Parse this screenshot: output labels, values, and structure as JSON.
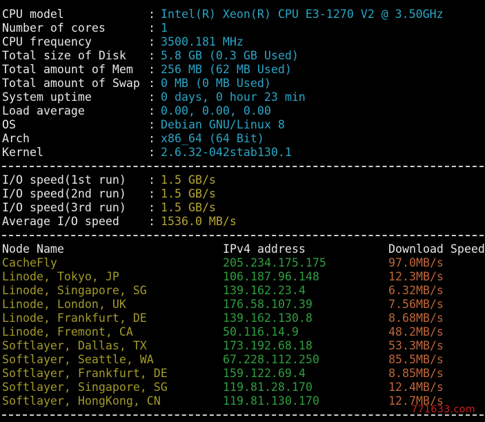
{
  "system_info": [
    {
      "label": "CPU model",
      "value": "Intel(R) Xeon(R) CPU E3-1270 V2 @ 3.50GHz"
    },
    {
      "label": "Number of cores",
      "value": "1"
    },
    {
      "label": "CPU frequency",
      "value": "3500.181 MHz"
    },
    {
      "label": "Total size of Disk",
      "value": "5.8 GB (0.3 GB Used)"
    },
    {
      "label": "Total amount of Mem",
      "value": "256 MB (62 MB Used)"
    },
    {
      "label": "Total amount of Swap",
      "value": "0 MB (0 MB Used)"
    },
    {
      "label": "System uptime",
      "value": "0 days, 0 hour 23 min"
    },
    {
      "label": "Load average",
      "value": "0.00, 0.00, 0.00"
    },
    {
      "label": "OS",
      "value": "Debian GNU/Linux 8"
    },
    {
      "label": "Arch",
      "value": "x86_64 (64 Bit)"
    },
    {
      "label": "Kernel",
      "value": "2.6.32-042stab130.1"
    }
  ],
  "io": [
    {
      "label": "I/O speed(1st run)",
      "value": "1.5 GB/s"
    },
    {
      "label": "I/O speed(2nd run)",
      "value": "1.5 GB/s"
    },
    {
      "label": "I/O speed(3rd run)",
      "value": "1.5 GB/s"
    },
    {
      "label": "Average I/O speed",
      "value": "1536.0 MB/s"
    }
  ],
  "separator": ":",
  "network": {
    "headers": {
      "node": "Node Name",
      "ip": "IPv4 address",
      "speed": "Download Speed"
    },
    "rows": [
      {
        "node": "CacheFly",
        "ip": "205.234.175.175",
        "speed": "97.0MB/s"
      },
      {
        "node": "Linode, Tokyo, JP",
        "ip": "106.187.96.148",
        "speed": "12.3MB/s"
      },
      {
        "node": "Linode, Singapore, SG",
        "ip": "139.162.23.4",
        "speed": "6.32MB/s"
      },
      {
        "node": "Linode, London, UK",
        "ip": "176.58.107.39",
        "speed": "7.56MB/s"
      },
      {
        "node": "Linode, Frankfurt, DE",
        "ip": "139.162.130.8",
        "speed": "8.68MB/s"
      },
      {
        "node": "Linode, Fremont, CA",
        "ip": "50.116.14.9",
        "speed": "48.2MB/s"
      },
      {
        "node": "Softlayer, Dallas, TX",
        "ip": "173.192.68.18",
        "speed": "53.3MB/s"
      },
      {
        "node": "Softlayer, Seattle, WA",
        "ip": "67.228.112.250",
        "speed": "85.5MB/s"
      },
      {
        "node": "Softlayer, Frankfurt, DE",
        "ip": "159.122.69.4",
        "speed": "8.85MB/s"
      },
      {
        "node": "Softlayer, Singapore, SG",
        "ip": "119.81.28.170",
        "speed": "12.4MB/s"
      },
      {
        "node": "Softlayer, HongKong, CN",
        "ip": "119.81.130.170",
        "speed": "12.7MB/s"
      }
    ]
  },
  "watermark": "771633.com",
  "colors": {
    "background": "#000000",
    "label": "#e8e8e8",
    "system_value": "#2aa6c6",
    "io_value": "#b5a636",
    "node_name": "#a39a2a",
    "ipv4": "#2f9e3f",
    "download_speed": "#c0663a",
    "watermark": "#d81e1e"
  }
}
